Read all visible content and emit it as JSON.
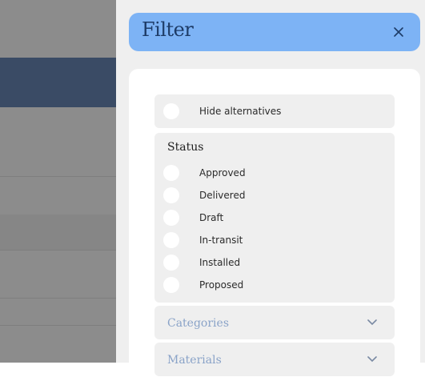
{
  "drawer": {
    "title": "Filter",
    "hide_alternatives_label": "Hide alternatives",
    "status": {
      "title": "Status",
      "options": [
        {
          "label": "Approved"
        },
        {
          "label": "Delivered"
        },
        {
          "label": "Draft"
        },
        {
          "label": "In-transit"
        },
        {
          "label": "Installed"
        },
        {
          "label": "Proposed"
        }
      ]
    },
    "categories_label": "Categories",
    "materials_label": "Materials"
  },
  "colors": {
    "header": "#7db3f5",
    "overlay": "rgba(45,45,45,0.55)"
  },
  "icons": {
    "close": "close-icon",
    "chevron": "chevron-down-icon"
  }
}
